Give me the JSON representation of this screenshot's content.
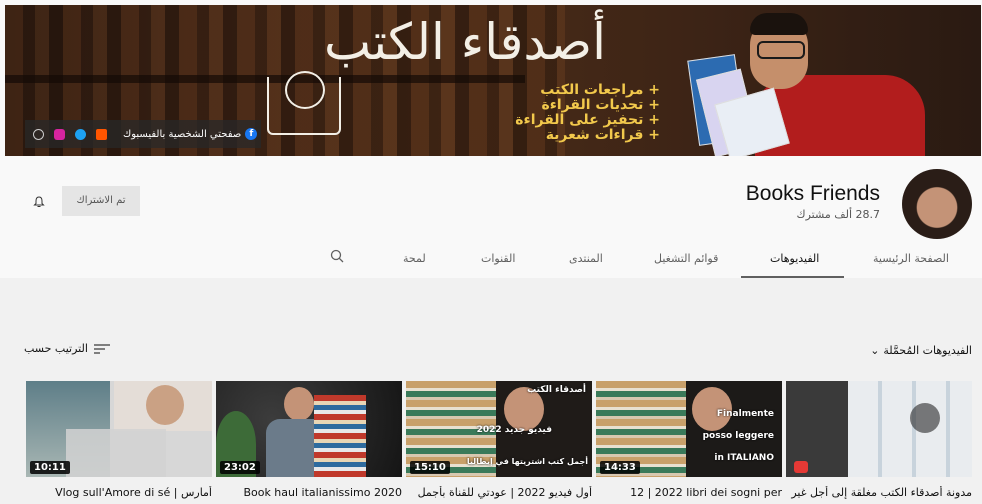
{
  "banner": {
    "title": "أصدقاء الكتب",
    "bullets": [
      "+ مراجعات الكتب",
      "+ تحديات القراءة",
      "+ تحفيز على القراءة",
      "+ قراءات شعرية"
    ],
    "facebook_label": "صفحتي الشخصية بالفيسبوك",
    "social_icons": [
      "facebook-icon",
      "soundcloud-icon",
      "twitter-icon",
      "instagram-icon",
      "globe-icon"
    ]
  },
  "channel": {
    "name": "Books Friends",
    "subscribers": "28.7 ألف مشترك",
    "subscribed_label": "تم الاشتراك"
  },
  "tabs": [
    {
      "label": "الصفحة الرئيسية"
    },
    {
      "label": "الفيديوهات"
    },
    {
      "label": "قوائم التشغيل"
    },
    {
      "label": "المنتدى"
    },
    {
      "label": "القنوات"
    },
    {
      "label": "لمحة"
    }
  ],
  "section": {
    "title": "الفيديوهات المُحمَّلة",
    "sort_label": "الترتيب حسب"
  },
  "videos": [
    {
      "title": "مدونة أصدقاء الكتب مغلقة إلى أجل غير",
      "duration": ""
    },
    {
      "title": "12 | 2022 libri dei sogni per",
      "duration": "14:33",
      "overlay": [
        "Finalmente",
        "posso leggere",
        "in ITALIANO"
      ]
    },
    {
      "title": "أول فيديو 2022 | عودتي للقناة بأجمل",
      "duration": "15:10",
      "overlay": [
        "أصدقاء الكتب",
        "فيديو جديد 2022",
        "أجمل كتب اشتريتها في إيطاليا"
      ]
    },
    {
      "title": "Book haul italianissimo 2020",
      "duration": "23:02"
    },
    {
      "title": "Vlog sull'Amore di sé | أمارس",
      "duration": "10:11"
    }
  ],
  "colors": {
    "accent_red": "#b21d1d",
    "banner_yellow": "#f2c94c",
    "tab_text": "#606060"
  }
}
